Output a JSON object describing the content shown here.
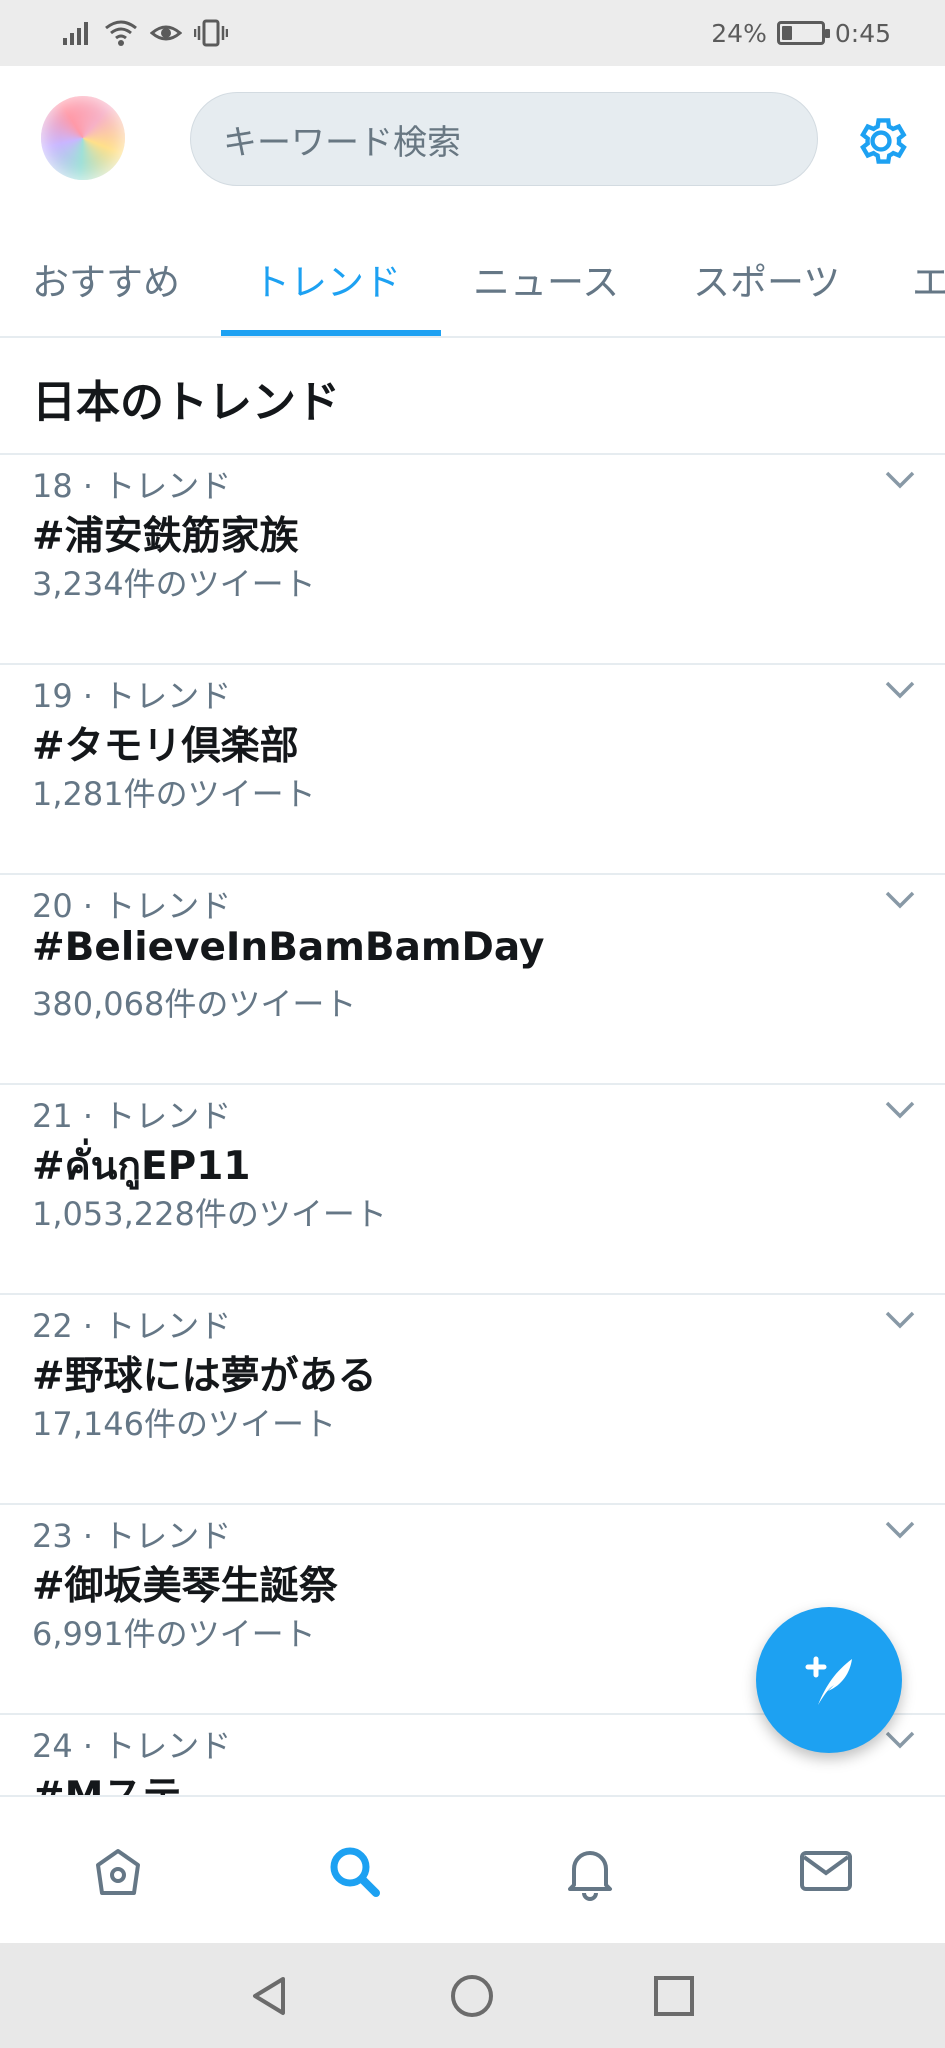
{
  "status_bar": {
    "battery": "24%",
    "battery_level": 0.24,
    "time": "0:45"
  },
  "search": {
    "placeholder": "キーワード検索"
  },
  "tabs": [
    {
      "label": "おすすめ",
      "active": false
    },
    {
      "label": "トレンド",
      "active": true
    },
    {
      "label": "ニュース",
      "active": false
    },
    {
      "label": "スポーツ",
      "active": false
    },
    {
      "label": "エ",
      "active": false
    }
  ],
  "section_title": "日本のトレンド",
  "trends": [
    {
      "meta": "18 · トレンド",
      "name": "#浦安鉄筋家族",
      "count": "3,234件のツイート"
    },
    {
      "meta": "19 · トレンド",
      "name": "#タモリ倶楽部",
      "count": "1,281件のツイート"
    },
    {
      "meta": "20 · トレンド",
      "name": "#BelieveInBamBamDay",
      "count": "380,068件のツイート"
    },
    {
      "meta": "21 · トレンド",
      "name": "#คั่นกูEP11",
      "count": "1,053,228件のツイート"
    },
    {
      "meta": "22 · トレンド",
      "name": "#野球には夢がある",
      "count": "17,146件のツイート"
    },
    {
      "meta": "23 · トレンド",
      "name": "#御坂美琴生誕祭",
      "count": "6,991件のツイート"
    },
    {
      "meta": "24 · トレンド",
      "name": "#Mステ",
      "count": ""
    }
  ],
  "colors": {
    "accent": "#1da1f2",
    "muted": "#657786",
    "text": "#14171a"
  },
  "icons": {
    "status": [
      "signal-icon",
      "wifi-icon",
      "eye-icon",
      "vibrate-icon"
    ],
    "bottom_nav": [
      "home-icon",
      "search-icon",
      "notifications-icon",
      "messages-icon"
    ],
    "system_nav": [
      "back-icon",
      "home-circle-icon",
      "recents-icon"
    ]
  }
}
